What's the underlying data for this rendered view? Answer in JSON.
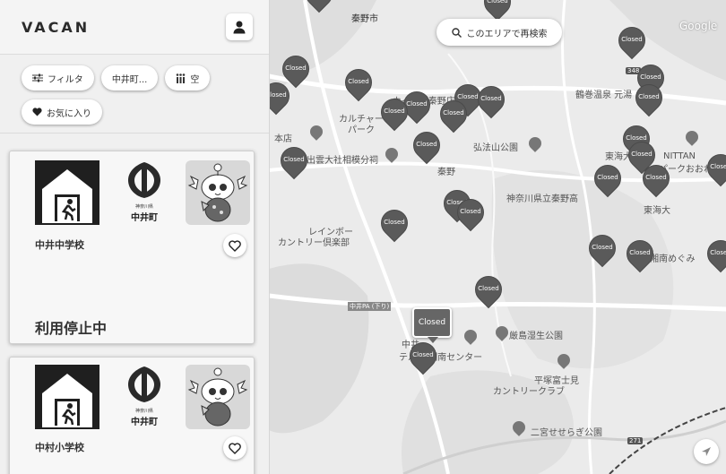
{
  "header": {
    "logo": "VACAN"
  },
  "filters": [
    {
      "label": "フィルタ",
      "icon": "sliders-icon"
    },
    {
      "label": "中井町...",
      "icon": ""
    },
    {
      "label": "空",
      "icon": "crowd-bars-icon"
    },
    {
      "label": "お気に入り",
      "icon": "heart-icon"
    }
  ],
  "cards": [
    {
      "title": "中井中学校",
      "status": "利用停止中",
      "town_logo_text": "中井町",
      "town_logo_small": "神奈川県"
    },
    {
      "title": "中村小学校",
      "status": "",
      "town_logo_text": "中井町",
      "town_logo_small": "神奈川県"
    }
  ],
  "map": {
    "search_label": "このエリアで再検索",
    "pin_label": "Closed",
    "selected_pin_label": "Closed",
    "google": "Google",
    "labels": [
      "秦野市",
      "カインズ秦野店",
      "鶴巻温泉 元湯",
      "カルチャー",
      "パーク",
      "本店",
      "弘法山公園",
      "出雲大社相模分祠",
      "秦野",
      "東海大",
      "NITTAN",
      "パークおおね",
      "神奈川県立秦野高",
      "東海大",
      "レインボー",
      "カントリー倶楽部",
      "ピア 湘南めぐみ",
      "中井PA (下り)",
      "厳島湿生公園",
      "中井",
      "テルモ 湘南センター",
      "平塚富士見",
      "カントリークラブ",
      "二宮せせらぎ公園",
      "271",
      "348"
    ]
  }
}
